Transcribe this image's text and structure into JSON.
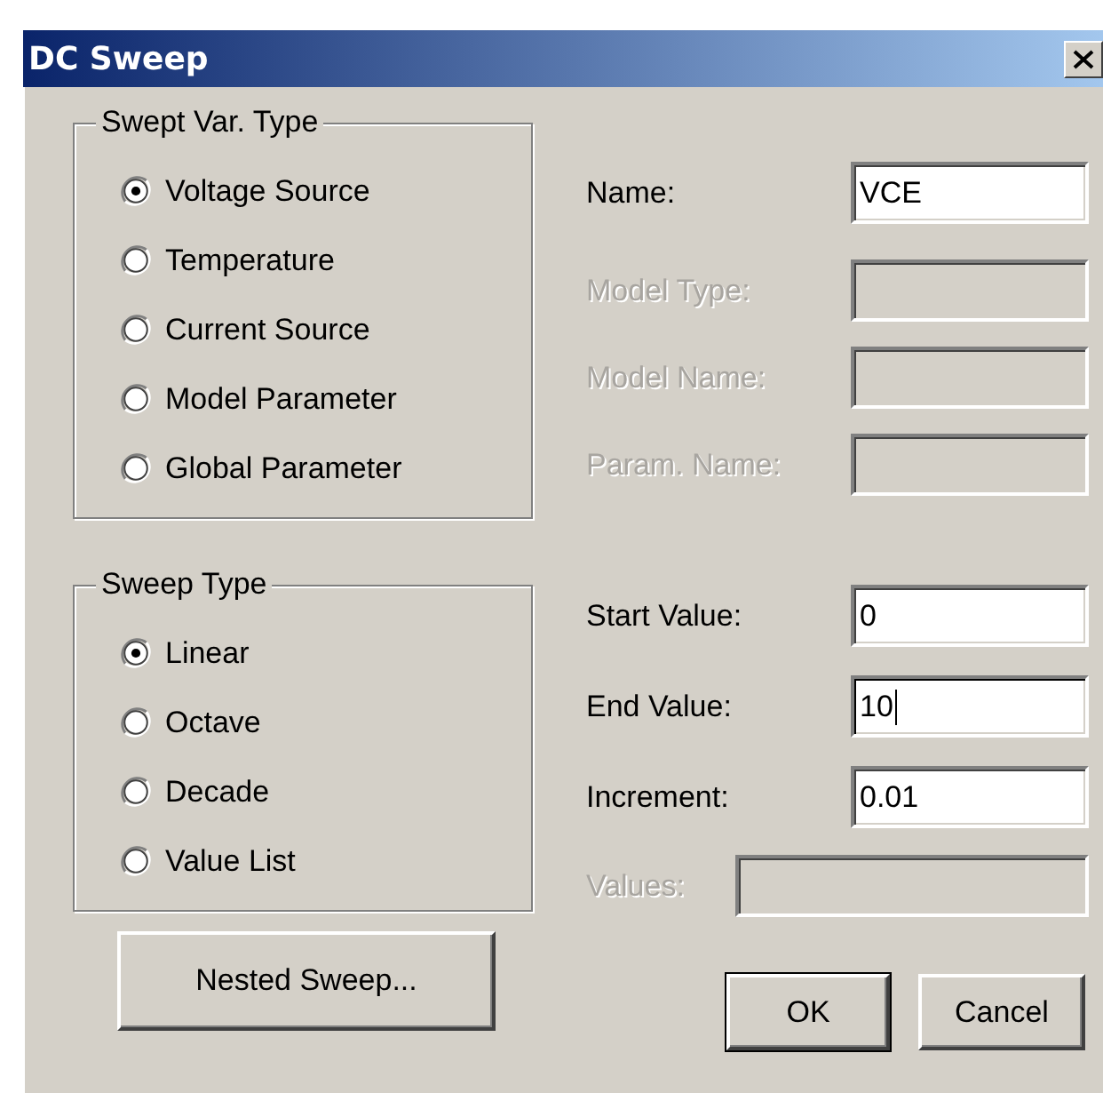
{
  "window": {
    "title": "DC Sweep"
  },
  "swept_var_type": {
    "title": "Swept Var. Type",
    "options": [
      {
        "label": "Voltage Source",
        "selected": true
      },
      {
        "label": "Temperature",
        "selected": false
      },
      {
        "label": "Current Source",
        "selected": false
      },
      {
        "label": "Model Parameter",
        "selected": false
      },
      {
        "label": "Global Parameter",
        "selected": false
      }
    ]
  },
  "sweep_type": {
    "title": "Sweep Type",
    "options": [
      {
        "label": "Linear",
        "selected": true
      },
      {
        "label": "Octave",
        "selected": false
      },
      {
        "label": "Decade",
        "selected": false
      },
      {
        "label": "Value List",
        "selected": false
      }
    ]
  },
  "name_field": {
    "label": "Name:",
    "value": "VCE",
    "disabled": false
  },
  "parameter_fields": [
    {
      "label": "Model Type:",
      "disabled": true
    },
    {
      "label": "Model Name:",
      "disabled": true
    },
    {
      "label": "Param. Name:",
      "disabled": true
    }
  ],
  "range_fields": [
    {
      "label": "Start Value:",
      "value": "0",
      "disabled": false,
      "focused": false
    },
    {
      "label": "End Value:",
      "value": "10",
      "disabled": false,
      "focused": true
    },
    {
      "label": "Increment:",
      "value": "0.01",
      "disabled": false,
      "focused": false
    }
  ],
  "values_field": {
    "label": "Values:",
    "disabled": true
  },
  "buttons": [
    {
      "label": "Nested Sweep...",
      "default": false
    },
    {
      "label": "OK",
      "default": true
    },
    {
      "label": "Cancel",
      "default": false
    }
  ]
}
